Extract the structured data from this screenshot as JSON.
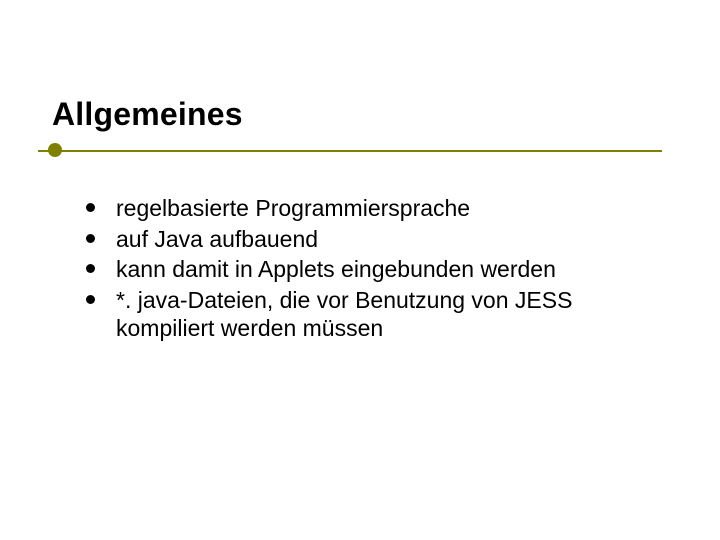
{
  "slide": {
    "title": "Allgemeines",
    "bullets": [
      "regelbasierte Programmiersprache",
      "auf Java aufbauend",
      "kann damit in Applets eingebunden werden",
      "*. java-Dateien, die vor Benutzung von JESS kompiliert werden müssen"
    ]
  }
}
